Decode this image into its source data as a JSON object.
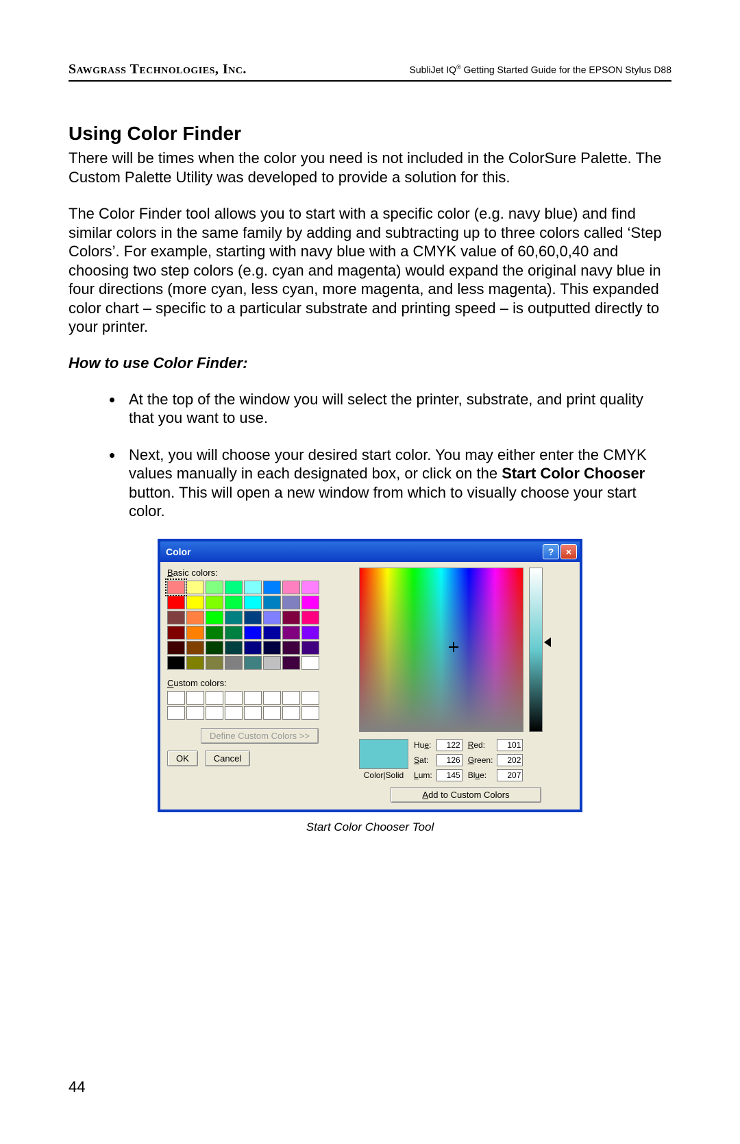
{
  "header": {
    "company": "Sawgrass Technologies, Inc.",
    "doc_title_prefix": "SubliJet IQ",
    "doc_title_suffix": " Getting Started Guide for the EPSON Stylus D88"
  },
  "section_title": "Using Color Finder",
  "para1": "There will be times when the color you need is not included in the ColorSure Palette.  The Custom Palette Utility was developed to provide a solution for this.",
  "para2": "The Color Finder tool allows you to start with a specific color (e.g. navy blue) and find similar colors in the same family by adding and subtracting up to three colors called ‘Step Colors’.  For example, starting with navy blue with a CMYK value of 60,60,0,40 and choosing two step colors (e.g. cyan and magenta) would expand the original navy blue in four directions (more cyan, less cyan, more magenta, and less magenta).  This expanded color chart – specific to a particular substrate and printing speed – is outputted directly to your printer.",
  "howto_heading": "How to use Color Finder:",
  "bullet1": "At the top of the window you will select the printer, substrate, and print quality that you want to use.",
  "bullet2_pre": "Next, you will choose your desired start color.  You may either enter the CMYK values manually in each designated box, or click on the ",
  "bullet2_bold": "Start Color Chooser",
  "bullet2_post": " button.  This will open a new window from which to visually choose your start color.",
  "dialog": {
    "title": "Color",
    "basic_label": "Basic colors:",
    "custom_label": "Custom colors:",
    "define_btn": "Define Custom Colors >>",
    "ok": "OK",
    "cancel": "Cancel",
    "colorsolid": "Color|Solid",
    "hue_lbl": "Hue:",
    "sat_lbl": "Sat:",
    "lum_lbl": "Lum:",
    "red_lbl": "Red:",
    "green_lbl": "Green:",
    "blue_lbl": "Blue:",
    "hue": "122",
    "sat": "126",
    "lum": "145",
    "red": "101",
    "green": "202",
    "blue": "207",
    "add_btn": "Add to Custom Colors",
    "basic_colors": [
      "#ff8080",
      "#ffff80",
      "#80ff80",
      "#00ff80",
      "#80ffff",
      "#0080ff",
      "#ff80c0",
      "#ff80ff",
      "#ff0000",
      "#ffff00",
      "#80ff00",
      "#00ff40",
      "#00ffff",
      "#0080c0",
      "#8080c0",
      "#ff00ff",
      "#804040",
      "#ff8040",
      "#00ff00",
      "#008080",
      "#004080",
      "#8080ff",
      "#800040",
      "#ff0080",
      "#800000",
      "#ff8000",
      "#008000",
      "#008040",
      "#0000ff",
      "#0000a0",
      "#800080",
      "#8000ff",
      "#400000",
      "#804000",
      "#004000",
      "#004040",
      "#000080",
      "#000040",
      "#400040",
      "#400080",
      "#000000",
      "#808000",
      "#808040",
      "#808080",
      "#408080",
      "#c0c0c0",
      "#400040",
      "#ffffff"
    ]
  },
  "caption": "Start Color Chooser Tool",
  "page_number": "44"
}
